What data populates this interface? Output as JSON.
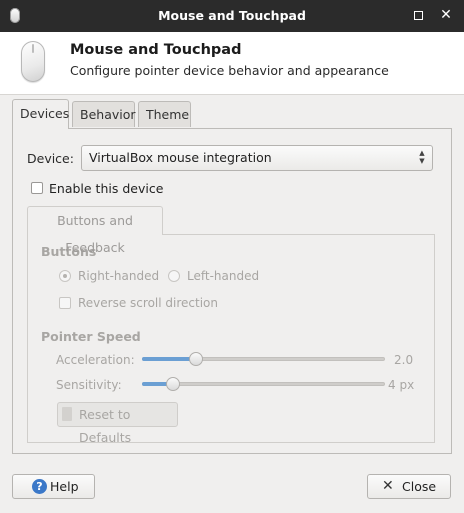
{
  "window": {
    "title": "Mouse and Touchpad",
    "close_glyph": "✕"
  },
  "header": {
    "title": "Mouse and Touchpad",
    "subtitle": "Configure pointer device behavior and appearance"
  },
  "tabs": [
    {
      "label": "Devices",
      "active": true
    },
    {
      "label": "Behavior",
      "active": false
    },
    {
      "label": "Theme",
      "active": false
    }
  ],
  "devices": {
    "device_label": "Device:",
    "device_value": "VirtualBox mouse integration",
    "enable_label": "Enable this device",
    "enable_checked": false,
    "subtab_label": "Buttons and Feedback",
    "buttons_heading": "Buttons",
    "right_handed_label": "Right-handed",
    "left_handed_label": "Left-handed",
    "selected_handedness": "right",
    "reverse_scroll_label": "Reverse scroll direction",
    "reverse_scroll_checked": false,
    "pointer_speed_heading": "Pointer Speed",
    "acceleration_label": "Acceleration:",
    "acceleration_value": "2.0",
    "sensitivity_label": "Sensitivity:",
    "sensitivity_value": "4 px",
    "reset_label": "Reset to Defaults",
    "enabled": false
  },
  "footer": {
    "help_label": "Help",
    "help_icon_glyph": "?",
    "close_label": "Close",
    "close_icon_glyph": "✕"
  },
  "colors": {
    "titlebar": "#2b2b2b",
    "slider_fill": "#6b9fd3",
    "help_icon": "#3b78c8",
    "disabled_text": "#a8a6a3"
  }
}
